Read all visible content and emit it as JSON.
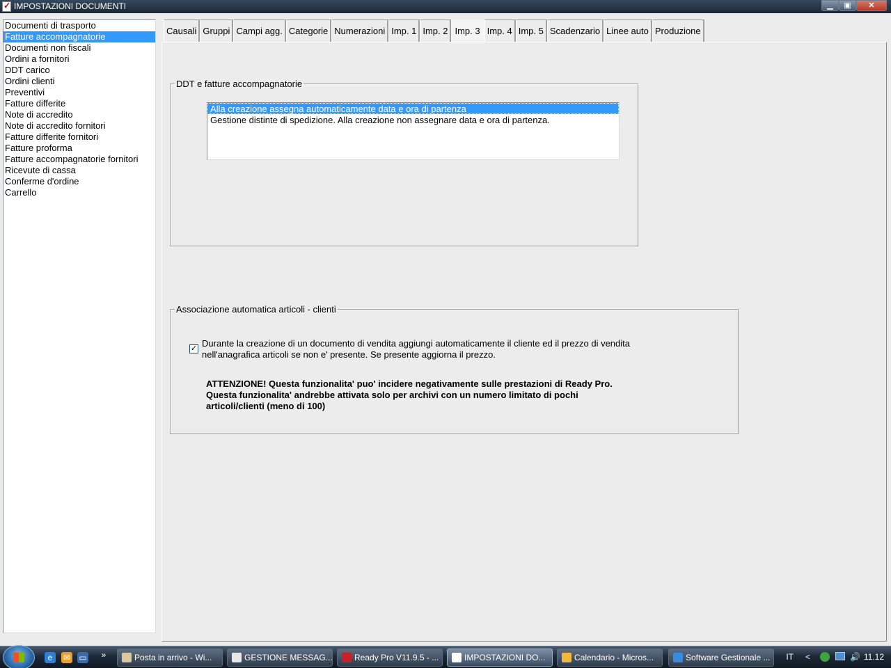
{
  "window": {
    "title": "IMPOSTAZIONI DOCUMENTI",
    "controls": {
      "minimize": "▁",
      "maximize": "▣",
      "close": "✕"
    }
  },
  "doc_list": {
    "selected_index": 1,
    "items": [
      "Documenti di trasporto",
      "Fatture accompagnatorie",
      "Documenti non fiscali",
      "Ordini a fornitori",
      "DDT carico",
      "Ordini clienti",
      "Preventivi",
      "Fatture differite",
      "Note di accredito",
      "Note di accredito fornitori",
      "Fatture differite fornitori",
      "Fatture proforma",
      "Fatture accompagnatorie fornitori",
      "Ricevute di cassa",
      "Conferme d'ordine",
      "Carrello"
    ]
  },
  "tabs": {
    "active": "Imp. 3",
    "items": [
      "Causali",
      "Gruppi",
      "Campi agg.",
      "Categorie",
      "Numerazioni",
      "Imp. 1",
      "Imp. 2",
      "Imp. 3",
      "Imp. 4",
      "Imp. 5",
      "Scadenzario",
      "Linee auto",
      "Produzione"
    ]
  },
  "group_ddt": {
    "legend": "DDT e fatture accompagnatorie",
    "selected_index": 0,
    "options": [
      "Alla creazione assegna automaticamente data e ora di partenza",
      "Gestione distinte di spedizione. Alla creazione non assegnare data e ora di partenza."
    ]
  },
  "group_assoc": {
    "legend": "Associazione automatica articoli - clienti",
    "checkbox_checked": true,
    "checkbox_mark": "✓",
    "checkbox_line1": "Durante la creazione di un documento di vendita aggiungi automaticamente il cliente ed il prezzo di vendita",
    "checkbox_line2": "nell'anagrafica articoli se non e' presente. Se presente aggiorna il prezzo.",
    "warning_line1": "ATTENZIONE! Questa funzionalita' puo' incidere negativamente sulle prestazioni di Ready Pro.",
    "warning_line2": "Questa funzionalita' andrebbe attivata solo per archivi con un numero limitato di pochi",
    "warning_line3": "articoli/clienti (meno di 100)"
  },
  "taskbar": {
    "more_icon": "»",
    "buttons": [
      {
        "label": "Posta in arrivo - Wi...",
        "icon": "mail-icon",
        "color": "#d8c9a0"
      },
      {
        "label": "GESTIONE MESSAG...",
        "icon": "envelope-icon",
        "color": "#e8e8e8"
      },
      {
        "label": "Ready Pro V11.9.5 - ...",
        "icon": "strawberry-icon",
        "color": "#c8202a"
      },
      {
        "label": "IMPOSTAZIONI DO...",
        "icon": "document-icon",
        "color": "#ffffff"
      },
      {
        "label": "Calendario - Micros...",
        "icon": "calendar-icon",
        "color": "#f0b840"
      },
      {
        "label": "Software Gestionale ...",
        "icon": "ie-icon",
        "color": "#3a8be0"
      }
    ],
    "active_index": 3,
    "tray": {
      "language": "IT",
      "chevron": "<",
      "volume": "🔊",
      "clock": "11.12"
    }
  }
}
